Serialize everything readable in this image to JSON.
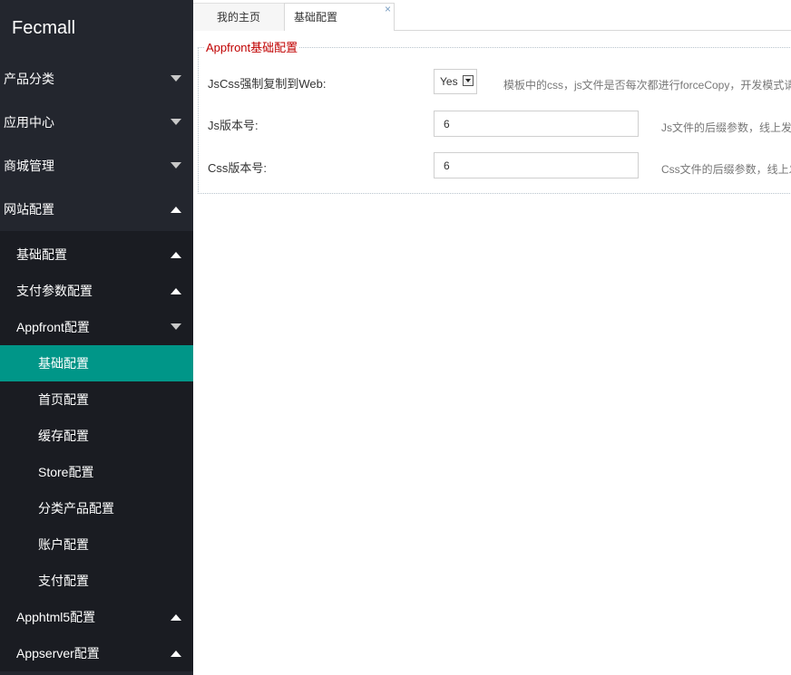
{
  "sidebar": {
    "logo": "Fecmall",
    "items": [
      {
        "label": "产品分类"
      },
      {
        "label": "应用中心"
      },
      {
        "label": "商城管理"
      },
      {
        "label": "网站配置"
      }
    ],
    "sub": [
      {
        "label": "基础配置"
      },
      {
        "label": "支付参数配置"
      },
      {
        "label": "Appfront配置"
      }
    ],
    "subsub": [
      {
        "label": "基础配置"
      },
      {
        "label": "首页配置"
      },
      {
        "label": "缓存配置"
      },
      {
        "label": "Store配置"
      },
      {
        "label": "分类产品配置"
      },
      {
        "label": "账户配置"
      },
      {
        "label": "支付配置"
      }
    ],
    "sub_after": [
      {
        "label": "Apphtml5配置"
      },
      {
        "label": "Appserver配置"
      }
    ]
  },
  "tabs": {
    "home": "我的主页",
    "current": "基础配置",
    "close": "×"
  },
  "form": {
    "legend": "Appfront基础配置",
    "rows": [
      {
        "label": "JsCss强制复制到Web:",
        "value": "Yes",
        "hint": "模板中的css，js文件是否每次都进行forceCopy，开发模式请"
      },
      {
        "label": "Js版本号:",
        "value": "6",
        "hint": "Js文件的后缀参数，线上发"
      },
      {
        "label": "Css版本号:",
        "value": "6",
        "hint": "Css文件的后缀参数，线上发"
      }
    ]
  },
  "colors": {
    "sidebar_bg": "#23262e",
    "submenu_bg": "#1a1c22",
    "active": "#009688",
    "legend": "#c00000"
  },
  "icons": {
    "collapse": "triangle-down-icon",
    "expand": "triangle-up-icon",
    "close": "close-icon",
    "select": "dropdown-arrow-icon"
  }
}
